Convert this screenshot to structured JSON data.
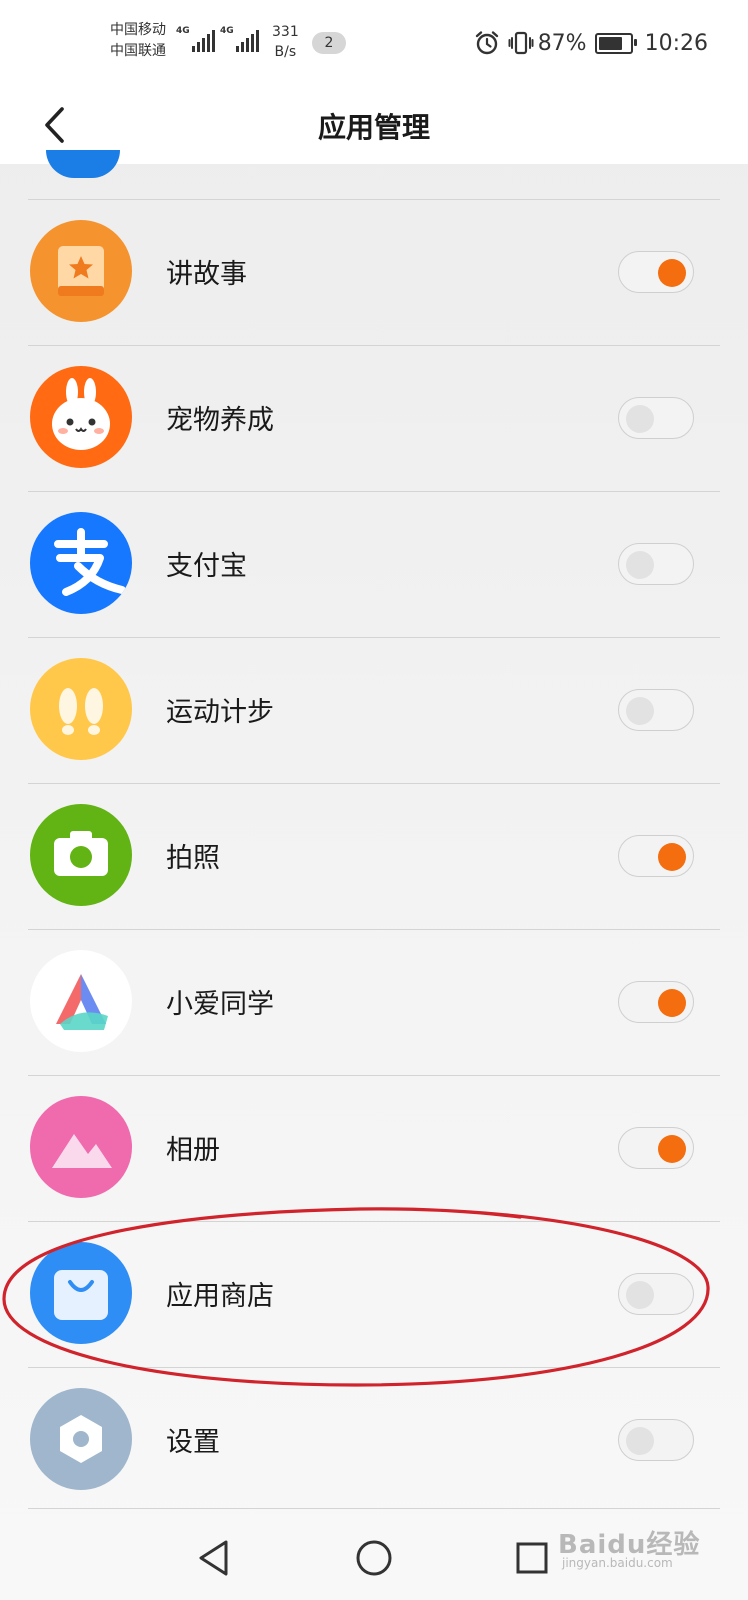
{
  "status_bar": {
    "carrier_1": "中国移动",
    "carrier_2": "中国联通",
    "network_type": "4G",
    "net_speed_value": "331",
    "net_speed_unit": "B/s",
    "notification_count": "2",
    "battery_percent": "87%",
    "battery_level": 0.87,
    "time": "10:26",
    "icons": [
      "alarm-icon",
      "vibrate-icon",
      "battery-icon"
    ]
  },
  "header": {
    "title": "应用管理",
    "back_icon": "chevron-left-icon"
  },
  "apps": [
    {
      "name": "讲故事",
      "icon": "storybook-icon",
      "icon_color": "#F5932F",
      "enabled": true
    },
    {
      "name": "宠物养成",
      "icon": "pet-bunny-icon",
      "icon_color": "#FF6A13",
      "enabled": false
    },
    {
      "name": "支付宝",
      "icon": "alipay-icon",
      "icon_color": "#1677FF",
      "enabled": false
    },
    {
      "name": "运动计步",
      "icon": "footsteps-icon",
      "icon_color": "#FFC84A",
      "enabled": false
    },
    {
      "name": "拍照",
      "icon": "camera-icon",
      "icon_color": "#62B314",
      "enabled": true
    },
    {
      "name": "小爱同学",
      "icon": "xiaoai-icon",
      "icon_color": "#FFFFFF",
      "enabled": true
    },
    {
      "name": "相册",
      "icon": "album-icon",
      "icon_color": "#F06AAE",
      "enabled": true
    },
    {
      "name": "应用商店",
      "icon": "app-store-bag-icon",
      "icon_color": "#2E8EF5",
      "enabled": false
    },
    {
      "name": "设置",
      "icon": "settings-hexagon-icon",
      "icon_color": "#9FB6CC",
      "enabled": false
    }
  ],
  "nav_bar": {
    "icons": [
      "back-triangle-icon",
      "home-circle-icon",
      "recents-square-icon"
    ]
  },
  "watermark": {
    "main": "Baidu经验",
    "sub": "jingyan.baidu.com"
  },
  "colors": {
    "toggle_on": "#F46D0E",
    "toggle_off_knob": "#E2E2E2",
    "annotation_circle": "#D0232B"
  }
}
